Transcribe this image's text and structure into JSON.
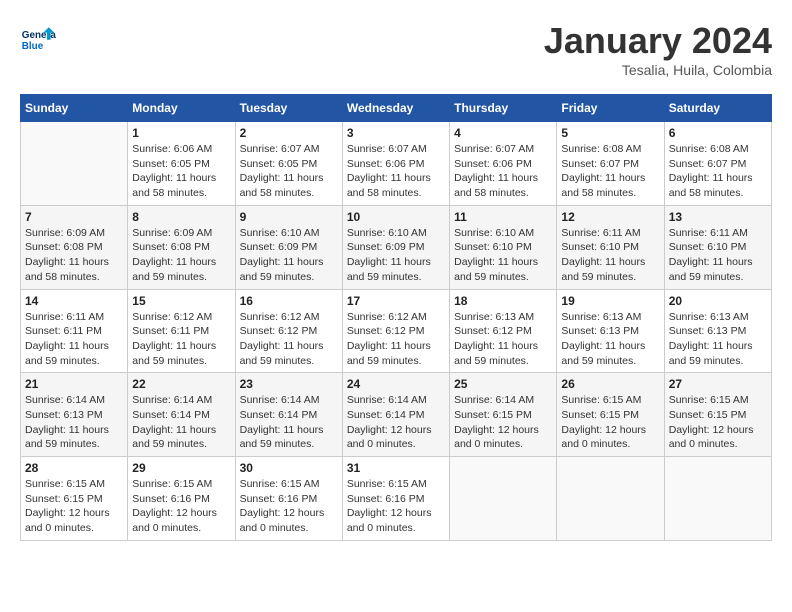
{
  "header": {
    "logo_general": "General",
    "logo_blue": "Blue",
    "month": "January 2024",
    "location": "Tesalia, Huila, Colombia"
  },
  "days_of_week": [
    "Sunday",
    "Monday",
    "Tuesday",
    "Wednesday",
    "Thursday",
    "Friday",
    "Saturday"
  ],
  "weeks": [
    [
      {
        "num": "",
        "empty": true
      },
      {
        "num": "1",
        "sunrise": "6:06 AM",
        "sunset": "6:05 PM",
        "daylight": "11 hours and 58 minutes."
      },
      {
        "num": "2",
        "sunrise": "6:07 AM",
        "sunset": "6:05 PM",
        "daylight": "11 hours and 58 minutes."
      },
      {
        "num": "3",
        "sunrise": "6:07 AM",
        "sunset": "6:06 PM",
        "daylight": "11 hours and 58 minutes."
      },
      {
        "num": "4",
        "sunrise": "6:07 AM",
        "sunset": "6:06 PM",
        "daylight": "11 hours and 58 minutes."
      },
      {
        "num": "5",
        "sunrise": "6:08 AM",
        "sunset": "6:07 PM",
        "daylight": "11 hours and 58 minutes."
      },
      {
        "num": "6",
        "sunrise": "6:08 AM",
        "sunset": "6:07 PM",
        "daylight": "11 hours and 58 minutes."
      }
    ],
    [
      {
        "num": "7",
        "sunrise": "6:09 AM",
        "sunset": "6:08 PM",
        "daylight": "11 hours and 58 minutes."
      },
      {
        "num": "8",
        "sunrise": "6:09 AM",
        "sunset": "6:08 PM",
        "daylight": "11 hours and 59 minutes."
      },
      {
        "num": "9",
        "sunrise": "6:10 AM",
        "sunset": "6:09 PM",
        "daylight": "11 hours and 59 minutes."
      },
      {
        "num": "10",
        "sunrise": "6:10 AM",
        "sunset": "6:09 PM",
        "daylight": "11 hours and 59 minutes."
      },
      {
        "num": "11",
        "sunrise": "6:10 AM",
        "sunset": "6:10 PM",
        "daylight": "11 hours and 59 minutes."
      },
      {
        "num": "12",
        "sunrise": "6:11 AM",
        "sunset": "6:10 PM",
        "daylight": "11 hours and 59 minutes."
      },
      {
        "num": "13",
        "sunrise": "6:11 AM",
        "sunset": "6:10 PM",
        "daylight": "11 hours and 59 minutes."
      }
    ],
    [
      {
        "num": "14",
        "sunrise": "6:11 AM",
        "sunset": "6:11 PM",
        "daylight": "11 hours and 59 minutes."
      },
      {
        "num": "15",
        "sunrise": "6:12 AM",
        "sunset": "6:11 PM",
        "daylight": "11 hours and 59 minutes."
      },
      {
        "num": "16",
        "sunrise": "6:12 AM",
        "sunset": "6:12 PM",
        "daylight": "11 hours and 59 minutes."
      },
      {
        "num": "17",
        "sunrise": "6:12 AM",
        "sunset": "6:12 PM",
        "daylight": "11 hours and 59 minutes."
      },
      {
        "num": "18",
        "sunrise": "6:13 AM",
        "sunset": "6:12 PM",
        "daylight": "11 hours and 59 minutes."
      },
      {
        "num": "19",
        "sunrise": "6:13 AM",
        "sunset": "6:13 PM",
        "daylight": "11 hours and 59 minutes."
      },
      {
        "num": "20",
        "sunrise": "6:13 AM",
        "sunset": "6:13 PM",
        "daylight": "11 hours and 59 minutes."
      }
    ],
    [
      {
        "num": "21",
        "sunrise": "6:14 AM",
        "sunset": "6:13 PM",
        "daylight": "11 hours and 59 minutes."
      },
      {
        "num": "22",
        "sunrise": "6:14 AM",
        "sunset": "6:14 PM",
        "daylight": "11 hours and 59 minutes."
      },
      {
        "num": "23",
        "sunrise": "6:14 AM",
        "sunset": "6:14 PM",
        "daylight": "11 hours and 59 minutes."
      },
      {
        "num": "24",
        "sunrise": "6:14 AM",
        "sunset": "6:14 PM",
        "daylight": "12 hours and 0 minutes."
      },
      {
        "num": "25",
        "sunrise": "6:14 AM",
        "sunset": "6:15 PM",
        "daylight": "12 hours and 0 minutes."
      },
      {
        "num": "26",
        "sunrise": "6:15 AM",
        "sunset": "6:15 PM",
        "daylight": "12 hours and 0 minutes."
      },
      {
        "num": "27",
        "sunrise": "6:15 AM",
        "sunset": "6:15 PM",
        "daylight": "12 hours and 0 minutes."
      }
    ],
    [
      {
        "num": "28",
        "sunrise": "6:15 AM",
        "sunset": "6:15 PM",
        "daylight": "12 hours and 0 minutes."
      },
      {
        "num": "29",
        "sunrise": "6:15 AM",
        "sunset": "6:16 PM",
        "daylight": "12 hours and 0 minutes."
      },
      {
        "num": "30",
        "sunrise": "6:15 AM",
        "sunset": "6:16 PM",
        "daylight": "12 hours and 0 minutes."
      },
      {
        "num": "31",
        "sunrise": "6:15 AM",
        "sunset": "6:16 PM",
        "daylight": "12 hours and 0 minutes."
      },
      {
        "num": "",
        "empty": true
      },
      {
        "num": "",
        "empty": true
      },
      {
        "num": "",
        "empty": true
      }
    ]
  ],
  "labels": {
    "sunrise": "Sunrise: ",
    "sunset": "Sunset: ",
    "daylight": "Daylight: "
  }
}
